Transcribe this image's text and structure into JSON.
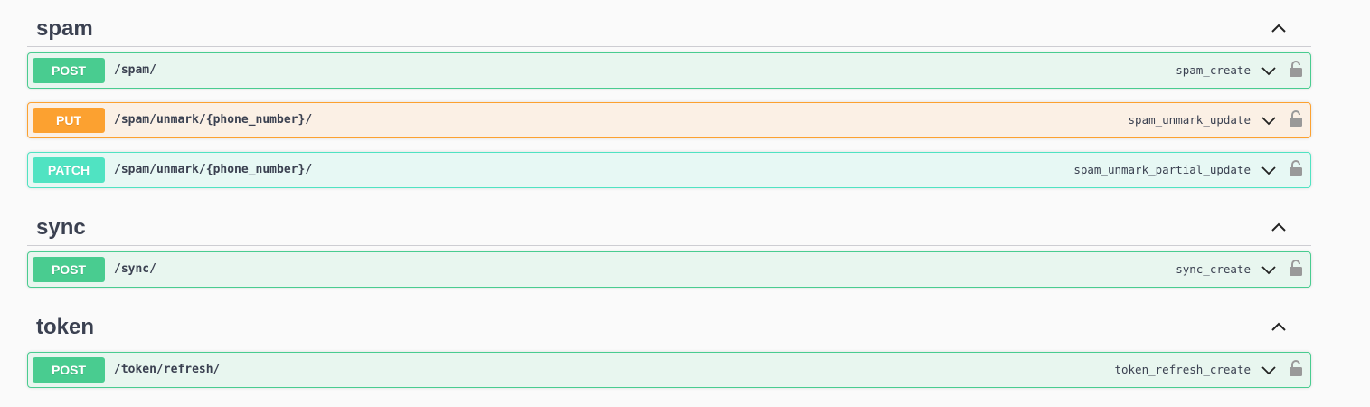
{
  "sections": [
    {
      "title": "spam",
      "toggle_icon": "chevron-up-icon",
      "operations": [
        {
          "method": "POST",
          "path": "/spam/",
          "operation_id": "spam_create",
          "color": "#49cc90"
        },
        {
          "method": "PUT",
          "path": "/spam/unmark/{phone_number}/",
          "operation_id": "spam_unmark_update",
          "color": "#fca130"
        },
        {
          "method": "PATCH",
          "path": "/spam/unmark/{phone_number}/",
          "operation_id": "spam_unmark_partial_update",
          "color": "#50e3c2"
        }
      ]
    },
    {
      "title": "sync",
      "toggle_icon": "chevron-up-icon",
      "operations": [
        {
          "method": "POST",
          "path": "/sync/",
          "operation_id": "sync_create",
          "color": "#49cc90"
        }
      ]
    },
    {
      "title": "token",
      "toggle_icon": "chevron-up-icon",
      "operations": [
        {
          "method": "POST",
          "path": "/token/refresh/",
          "operation_id": "token_refresh_create",
          "color": "#49cc90"
        }
      ]
    }
  ],
  "icons": {
    "expand": "chevron-down-icon",
    "auth": "lock-icon"
  }
}
